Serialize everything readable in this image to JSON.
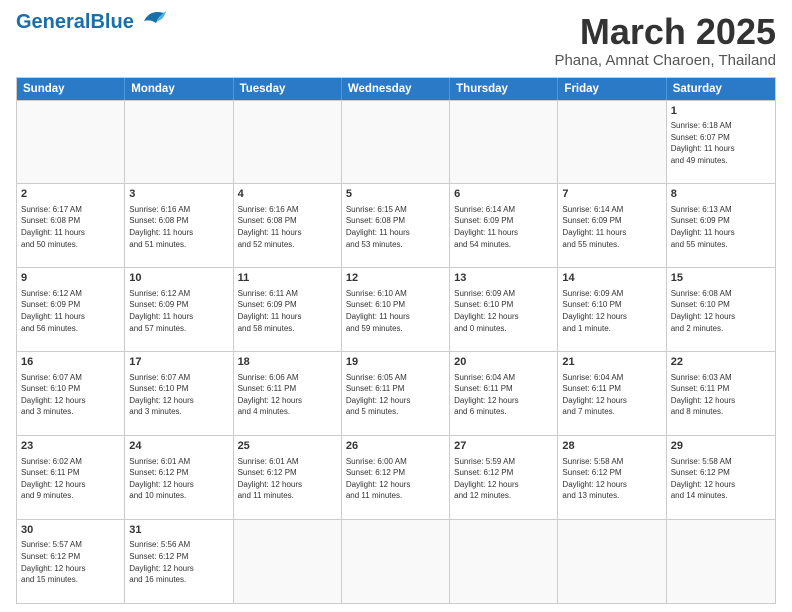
{
  "header": {
    "logo_general": "General",
    "logo_blue": "Blue",
    "main_title": "March 2025",
    "sub_title": "Phana, Amnat Charoen, Thailand"
  },
  "days_of_week": [
    "Sunday",
    "Monday",
    "Tuesday",
    "Wednesday",
    "Thursday",
    "Friday",
    "Saturday"
  ],
  "weeks": [
    [
      {
        "day": "",
        "info": ""
      },
      {
        "day": "",
        "info": ""
      },
      {
        "day": "",
        "info": ""
      },
      {
        "day": "",
        "info": ""
      },
      {
        "day": "",
        "info": ""
      },
      {
        "day": "",
        "info": ""
      },
      {
        "day": "1",
        "info": "Sunrise: 6:18 AM\nSunset: 6:07 PM\nDaylight: 11 hours\nand 49 minutes."
      }
    ],
    [
      {
        "day": "2",
        "info": "Sunrise: 6:17 AM\nSunset: 6:08 PM\nDaylight: 11 hours\nand 50 minutes."
      },
      {
        "day": "3",
        "info": "Sunrise: 6:16 AM\nSunset: 6:08 PM\nDaylight: 11 hours\nand 51 minutes."
      },
      {
        "day": "4",
        "info": "Sunrise: 6:16 AM\nSunset: 6:08 PM\nDaylight: 11 hours\nand 52 minutes."
      },
      {
        "day": "5",
        "info": "Sunrise: 6:15 AM\nSunset: 6:08 PM\nDaylight: 11 hours\nand 53 minutes."
      },
      {
        "day": "6",
        "info": "Sunrise: 6:14 AM\nSunset: 6:09 PM\nDaylight: 11 hours\nand 54 minutes."
      },
      {
        "day": "7",
        "info": "Sunrise: 6:14 AM\nSunset: 6:09 PM\nDaylight: 11 hours\nand 55 minutes."
      },
      {
        "day": "8",
        "info": "Sunrise: 6:13 AM\nSunset: 6:09 PM\nDaylight: 11 hours\nand 55 minutes."
      }
    ],
    [
      {
        "day": "9",
        "info": "Sunrise: 6:12 AM\nSunset: 6:09 PM\nDaylight: 11 hours\nand 56 minutes."
      },
      {
        "day": "10",
        "info": "Sunrise: 6:12 AM\nSunset: 6:09 PM\nDaylight: 11 hours\nand 57 minutes."
      },
      {
        "day": "11",
        "info": "Sunrise: 6:11 AM\nSunset: 6:09 PM\nDaylight: 11 hours\nand 58 minutes."
      },
      {
        "day": "12",
        "info": "Sunrise: 6:10 AM\nSunset: 6:10 PM\nDaylight: 11 hours\nand 59 minutes."
      },
      {
        "day": "13",
        "info": "Sunrise: 6:09 AM\nSunset: 6:10 PM\nDaylight: 12 hours\nand 0 minutes."
      },
      {
        "day": "14",
        "info": "Sunrise: 6:09 AM\nSunset: 6:10 PM\nDaylight: 12 hours\nand 1 minute."
      },
      {
        "day": "15",
        "info": "Sunrise: 6:08 AM\nSunset: 6:10 PM\nDaylight: 12 hours\nand 2 minutes."
      }
    ],
    [
      {
        "day": "16",
        "info": "Sunrise: 6:07 AM\nSunset: 6:10 PM\nDaylight: 12 hours\nand 3 minutes."
      },
      {
        "day": "17",
        "info": "Sunrise: 6:07 AM\nSunset: 6:10 PM\nDaylight: 12 hours\nand 3 minutes."
      },
      {
        "day": "18",
        "info": "Sunrise: 6:06 AM\nSunset: 6:11 PM\nDaylight: 12 hours\nand 4 minutes."
      },
      {
        "day": "19",
        "info": "Sunrise: 6:05 AM\nSunset: 6:11 PM\nDaylight: 12 hours\nand 5 minutes."
      },
      {
        "day": "20",
        "info": "Sunrise: 6:04 AM\nSunset: 6:11 PM\nDaylight: 12 hours\nand 6 minutes."
      },
      {
        "day": "21",
        "info": "Sunrise: 6:04 AM\nSunset: 6:11 PM\nDaylight: 12 hours\nand 7 minutes."
      },
      {
        "day": "22",
        "info": "Sunrise: 6:03 AM\nSunset: 6:11 PM\nDaylight: 12 hours\nand 8 minutes."
      }
    ],
    [
      {
        "day": "23",
        "info": "Sunrise: 6:02 AM\nSunset: 6:11 PM\nDaylight: 12 hours\nand 9 minutes."
      },
      {
        "day": "24",
        "info": "Sunrise: 6:01 AM\nSunset: 6:12 PM\nDaylight: 12 hours\nand 10 minutes."
      },
      {
        "day": "25",
        "info": "Sunrise: 6:01 AM\nSunset: 6:12 PM\nDaylight: 12 hours\nand 11 minutes."
      },
      {
        "day": "26",
        "info": "Sunrise: 6:00 AM\nSunset: 6:12 PM\nDaylight: 12 hours\nand 11 minutes."
      },
      {
        "day": "27",
        "info": "Sunrise: 5:59 AM\nSunset: 6:12 PM\nDaylight: 12 hours\nand 12 minutes."
      },
      {
        "day": "28",
        "info": "Sunrise: 5:58 AM\nSunset: 6:12 PM\nDaylight: 12 hours\nand 13 minutes."
      },
      {
        "day": "29",
        "info": "Sunrise: 5:58 AM\nSunset: 6:12 PM\nDaylight: 12 hours\nand 14 minutes."
      }
    ],
    [
      {
        "day": "30",
        "info": "Sunrise: 5:57 AM\nSunset: 6:12 PM\nDaylight: 12 hours\nand 15 minutes."
      },
      {
        "day": "31",
        "info": "Sunrise: 5:56 AM\nSunset: 6:12 PM\nDaylight: 12 hours\nand 16 minutes."
      },
      {
        "day": "",
        "info": ""
      },
      {
        "day": "",
        "info": ""
      },
      {
        "day": "",
        "info": ""
      },
      {
        "day": "",
        "info": ""
      },
      {
        "day": "",
        "info": ""
      }
    ]
  ]
}
